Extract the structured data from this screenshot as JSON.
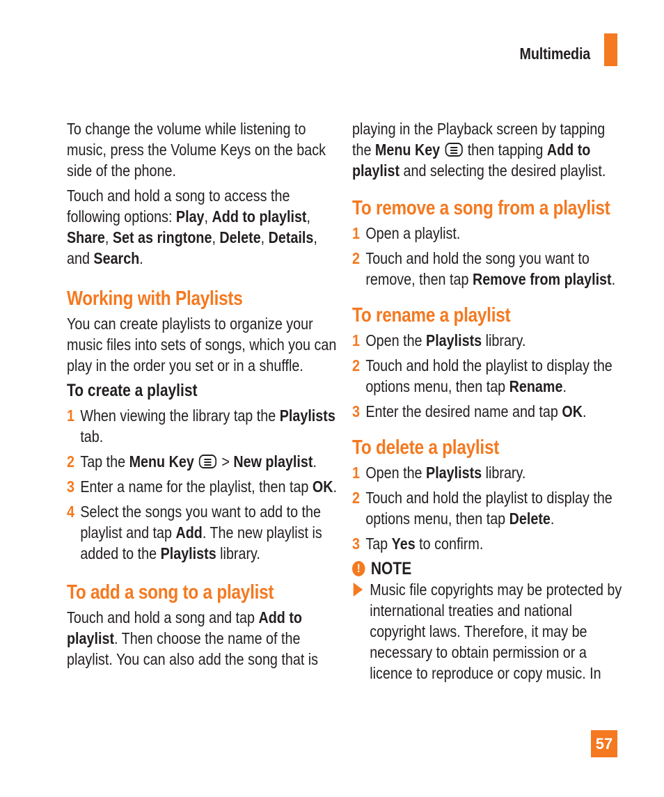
{
  "header": {
    "section": "Multimedia",
    "accent": "#f47920"
  },
  "page_number": "57",
  "left": {
    "intro1": "To change the volume while listening to music, press the Volume Keys on the back side of the phone.",
    "intro2": {
      "prefix": "Touch and hold a song to access the following options: ",
      "opt1": "Play",
      "sep1": ", ",
      "opt2": "Add to playlist",
      "sep2": ", ",
      "opt3": "Share",
      "sep3": ", ",
      "opt4": "Set as ringtone",
      "sep4": ", ",
      "opt5": "Delete",
      "sep5": ", ",
      "opt6": "Details",
      "sep6": ", and ",
      "opt7": "Search",
      "end": "."
    },
    "working_heading": "Working with Playlists",
    "working_body": "You can create playlists to organize your music files into sets of songs, which you can play in the order you set or in a shuffle.",
    "create_heading": "To create a playlist",
    "create_steps": [
      {
        "num": "1",
        "a": "When viewing the library tap the ",
        "b": "Playlists",
        "c": " tab."
      },
      {
        "num": "2",
        "a": "Tap the ",
        "b": "Menu Key",
        "c": " > ",
        "d": "New playlist",
        "e": "."
      },
      {
        "num": "3",
        "a": "Enter a name for the playlist, then tap ",
        "b": "OK",
        "c": "."
      },
      {
        "num": "4",
        "a": "Select the songs you want to add to the playlist and tap ",
        "b": "Add",
        "c": ". The new playlist is added to the ",
        "d": "Playlists",
        "e": " library."
      }
    ],
    "add_heading": "To add a song to a playlist",
    "add_body": {
      "a": "Touch and hold a song and tap ",
      "b": "Add to playlist",
      "c": ". Then choose the name of the playlist. You can also add the song that is"
    }
  },
  "right": {
    "cont": {
      "a": "playing in the Playback screen by tapping the ",
      "b": "Menu Key",
      "c": " then tapping ",
      "d": "Add to playlist",
      "e": " and selecting the desired playlist."
    },
    "remove_heading": "To remove a song from a playlist",
    "remove_steps": [
      {
        "num": "1",
        "a": "Open a playlist."
      },
      {
        "num": "2",
        "a": "Touch and hold the song you want to remove, then tap ",
        "b": "Remove from playlist",
        "c": "."
      }
    ],
    "rename_heading": "To rename a playlist",
    "rename_steps": [
      {
        "num": "1",
        "a": "Open the ",
        "b": "Playlists",
        "c": " library."
      },
      {
        "num": "2",
        "a": "Touch and hold the playlist to display the options menu, then tap ",
        "b": "Rename",
        "c": "."
      },
      {
        "num": "3",
        "a": "Enter the desired name and tap ",
        "b": "OK",
        "c": "."
      }
    ],
    "delete_heading": "To delete a playlist",
    "delete_steps": [
      {
        "num": "1",
        "a": "Open the ",
        "b": "Playlists",
        "c": " library."
      },
      {
        "num": "2",
        "a": "Touch and hold the playlist to display the options menu, then tap ",
        "b": "Delete",
        "c": "."
      },
      {
        "num": "3",
        "a": "Tap ",
        "b": "Yes",
        "c": " to confirm."
      }
    ],
    "note_label": "NOTE",
    "note_icon": "!",
    "note_text": "Music file copyrights may be protected by international treaties and national copyright laws. Therefore, it may be necessary to obtain permission or a licence to reproduce or copy music. In"
  }
}
